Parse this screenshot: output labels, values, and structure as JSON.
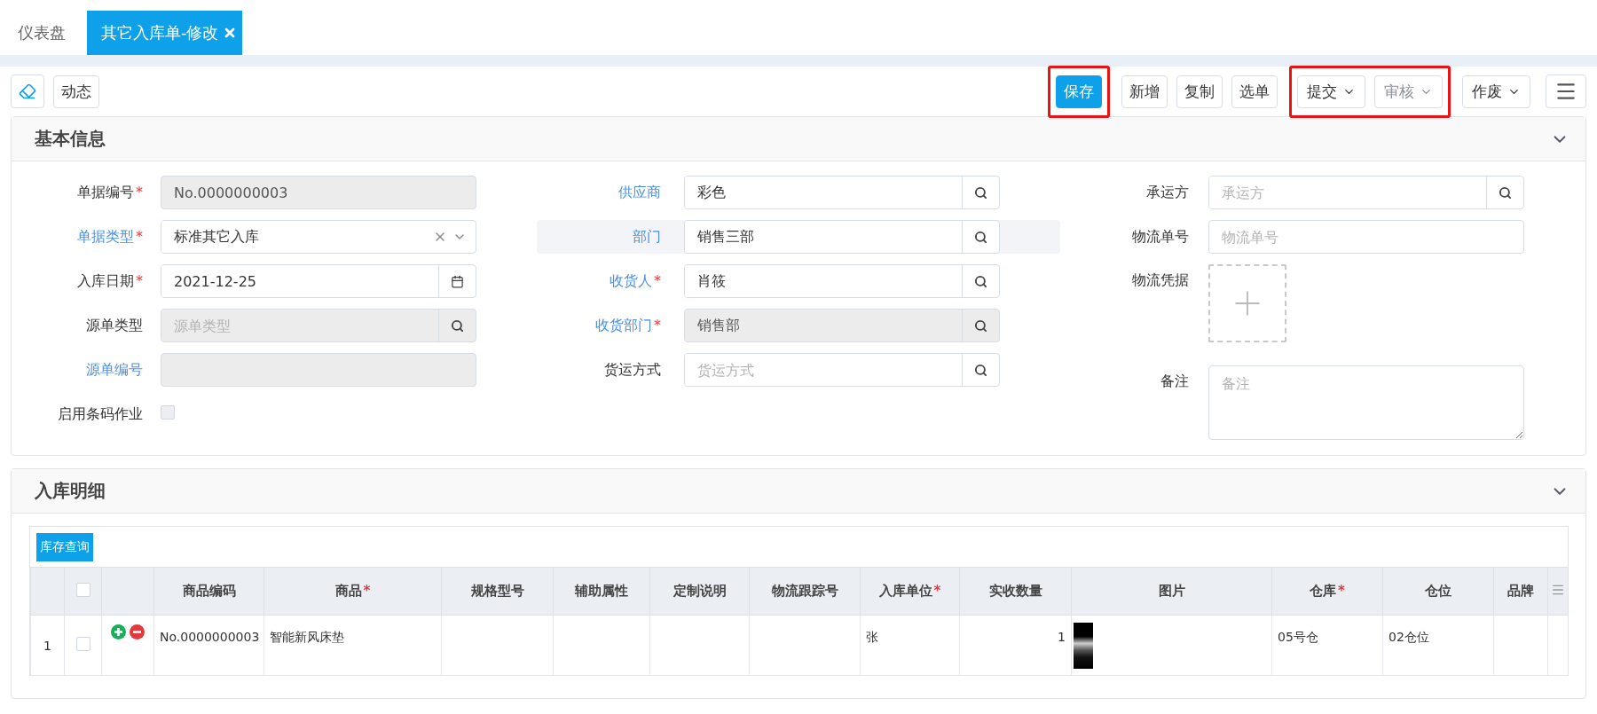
{
  "tabs": [
    {
      "label": "仪表盘",
      "selected": false,
      "closable": false
    },
    {
      "label": "其它入库单-修改",
      "selected": true,
      "closable": true
    }
  ],
  "toolbar": {
    "left": [
      {
        "kind": "icon"
      },
      {
        "kind": "plain",
        "label": "动态"
      }
    ],
    "right_groups": [
      {
        "highlighted": true,
        "buttons": [
          {
            "kind": "primary",
            "label": "保存",
            "disabled": false
          }
        ]
      },
      {
        "highlighted": false,
        "buttons": [
          {
            "kind": "plain",
            "label": "新增",
            "disabled": false
          },
          {
            "kind": "plain",
            "label": "复制",
            "disabled": false
          },
          {
            "kind": "plain",
            "label": "选单",
            "disabled": false
          }
        ]
      },
      {
        "highlighted": true,
        "buttons": [
          {
            "kind": "dropdown",
            "label": "提交",
            "disabled": false
          },
          {
            "kind": "dropdown",
            "label": "审核",
            "disabled": true
          }
        ]
      },
      {
        "highlighted": false,
        "buttons": [
          {
            "kind": "dropdown",
            "label": "作废",
            "disabled": false
          }
        ]
      }
    ],
    "menu": true
  },
  "basic_info": {
    "title": "基本信息",
    "expanded": true,
    "columns": [
      [
        {
          "kind": "text",
          "label": "单据编号",
          "mark": "*",
          "link": false,
          "value": "No.0000000003",
          "disabled": true,
          "highlighted": false
        },
        {
          "kind": "select",
          "label": "单据类型",
          "mark": "*",
          "link": true,
          "value": "标准其它入库",
          "disabled": false,
          "highlighted": false
        },
        {
          "kind": "date",
          "label": "入库日期",
          "mark": "*",
          "link": false,
          "value": "2021-12-25",
          "disabled": false,
          "highlighted": false
        },
        {
          "kind": "lookup",
          "label": "源单类型",
          "link": false,
          "placeholder": "源单类型",
          "disabled": true,
          "highlighted": false
        },
        {
          "kind": "text",
          "label": "源单编号",
          "link": true,
          "disabled": true,
          "highlighted": false
        },
        {
          "kind": "checkbox",
          "label": "启用条码作业",
          "link": false,
          "checked": false,
          "disabled": true,
          "highlighted": false
        }
      ],
      [
        {
          "kind": "lookup",
          "label": "供应商",
          "link": true,
          "value": "彩色",
          "disabled": false,
          "highlighted": false
        },
        {
          "kind": "lookup",
          "label": "部门",
          "link": true,
          "value": "销售三部",
          "disabled": false,
          "highlighted": true
        },
        {
          "kind": "lookup",
          "label": "收货人",
          "mark": "*",
          "link": true,
          "value": "肖筱",
          "disabled": false,
          "highlighted": false
        },
        {
          "kind": "lookup",
          "label": "收货部门",
          "mark": "*",
          "link": true,
          "value": "销售部",
          "disabled": true,
          "highlighted": false
        },
        {
          "kind": "lookup",
          "label": "货运方式",
          "link": false,
          "placeholder": "货运方式",
          "disabled": false,
          "highlighted": false
        }
      ],
      [
        {
          "kind": "lookup",
          "label": "承运方",
          "link": false,
          "placeholder": "承运方",
          "disabled": false,
          "highlighted": false
        },
        {
          "kind": "text",
          "label": "物流单号",
          "link": false,
          "placeholder": "物流单号",
          "disabled": false,
          "highlighted": false
        },
        {
          "kind": "upload",
          "label": "物流凭据",
          "link": false,
          "highlighted": false
        },
        {
          "kind": "textarea",
          "label": "备注",
          "link": false,
          "placeholder": "备注",
          "highlighted": false
        }
      ]
    ]
  },
  "details": {
    "title": "入库明细",
    "expanded": true,
    "query_button": "库存查询",
    "header_checked": false,
    "columns": [
      {
        "label": "商品编码"
      },
      {
        "label": "商品",
        "mark": "*"
      },
      {
        "label": "规格型号"
      },
      {
        "label": "辅助属性"
      },
      {
        "label": "定制说明"
      },
      {
        "label": "物流跟踪号"
      },
      {
        "label": "入库单位",
        "mark": "*"
      },
      {
        "label": "实收数量"
      },
      {
        "label": "图片"
      },
      {
        "label": "仓库",
        "mark": "*"
      },
      {
        "label": "仓位"
      },
      {
        "label": "品牌"
      }
    ],
    "rows": [
      {
        "index": "1",
        "checked": false,
        "cells": [
          {
            "kind": "text",
            "text": "No.0000000003"
          },
          {
            "kind": "text",
            "text": "智能新风床垫"
          },
          {
            "kind": "empty"
          },
          {
            "kind": "empty"
          },
          {
            "kind": "empty"
          },
          {
            "kind": "empty"
          },
          {
            "kind": "text",
            "text": "张"
          },
          {
            "kind": "number",
            "text": "1"
          },
          {
            "kind": "image"
          },
          {
            "kind": "text",
            "text": "05号仓"
          },
          {
            "kind": "text",
            "text": "02仓位"
          },
          {
            "kind": "empty"
          }
        ]
      }
    ]
  }
}
